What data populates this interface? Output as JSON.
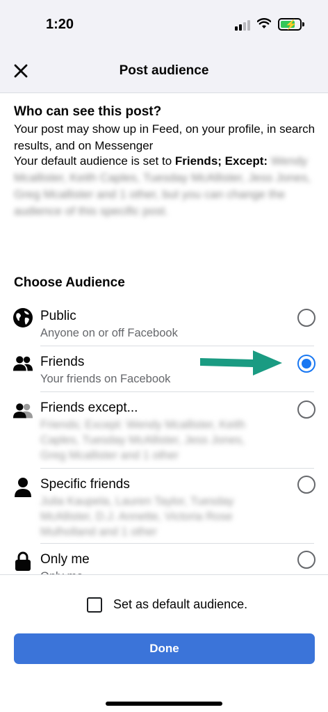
{
  "status_bar": {
    "time": "1:20"
  },
  "header": {
    "title": "Post audience",
    "close_icon": "close-icon"
  },
  "intro": {
    "title": "Who can see this post?",
    "description": "Your post may show up in Feed, on your profile, in search results, and on Messenger",
    "default_prefix": "Your default audience is set to ",
    "default_bold": "Friends; Except:",
    "default_blurred": "Wendy Mcallister, Keith Caples, Tuesday McAllister, Jess Jones, Greg Mcallister and 1 other",
    "default_suffix": ", but you can change the audience of this specific post."
  },
  "choose": {
    "title": "Choose Audience",
    "options": [
      {
        "label": "Public",
        "sub": "Anyone on or off Facebook",
        "icon": "globe-icon",
        "selected": false
      },
      {
        "label": "Friends",
        "sub": "Your friends on Facebook",
        "icon": "friends-icon",
        "selected": true
      },
      {
        "label": "Friends except...",
        "sub": "Friends; Except: Wendy Mcallister, Keith Caples, Tuesday McAllister, Jess Jones, Greg Mcallister and 1 other",
        "icon": "friends-except-icon",
        "selected": false
      },
      {
        "label": "Specific friends",
        "sub": "Julia Kaupela, Lauren Taylor, Tuesday McAllister, D.J. Annette, Victoria Rose Mulholland and 1 other",
        "icon": "person-icon",
        "selected": false
      },
      {
        "label": "Only me",
        "sub": "Only me",
        "icon": "lock-icon",
        "selected": false
      }
    ]
  },
  "footer": {
    "checkbox_label": "Set as default audience.",
    "checkbox_checked": false,
    "done_label": "Done"
  },
  "colors": {
    "accent": "#1877f2",
    "done_button": "#3b74d9",
    "arrow": "#1a9b82"
  }
}
